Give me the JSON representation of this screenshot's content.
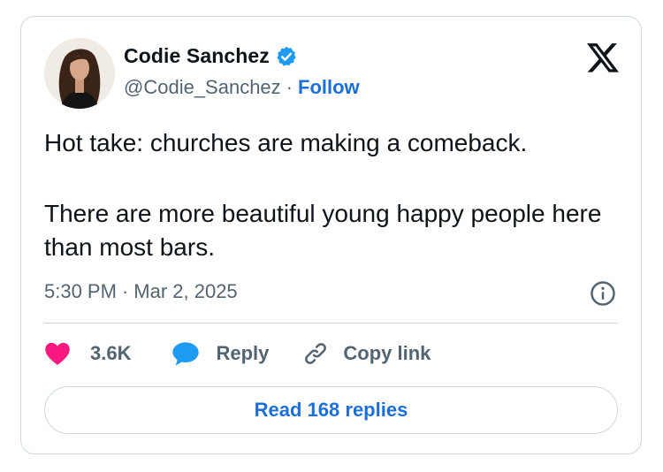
{
  "author": {
    "name": "Codie Sanchez",
    "handle": "@Codie_Sanchez",
    "separator": "·",
    "follow_label": "Follow",
    "verified_color": "#1d9bf0"
  },
  "tweet": {
    "paragraphs": [
      "Hot take: churches are making a comeback.",
      "There are more beautiful young happy people here than most bars."
    ],
    "time": "5:30 PM",
    "date_separator": "·",
    "date": "Mar 2, 2025"
  },
  "actions": {
    "likes_count": "3.6K",
    "like_color": "#f91880",
    "reply_label": "Reply",
    "reply_color": "#1d9bf0",
    "copy_label": "Copy link"
  },
  "footer": {
    "read_replies_label": "Read 168 replies"
  },
  "icons": [
    "verified-badge-icon",
    "x-logo-icon",
    "info-icon",
    "heart-icon",
    "reply-bubble-icon",
    "link-icon"
  ]
}
